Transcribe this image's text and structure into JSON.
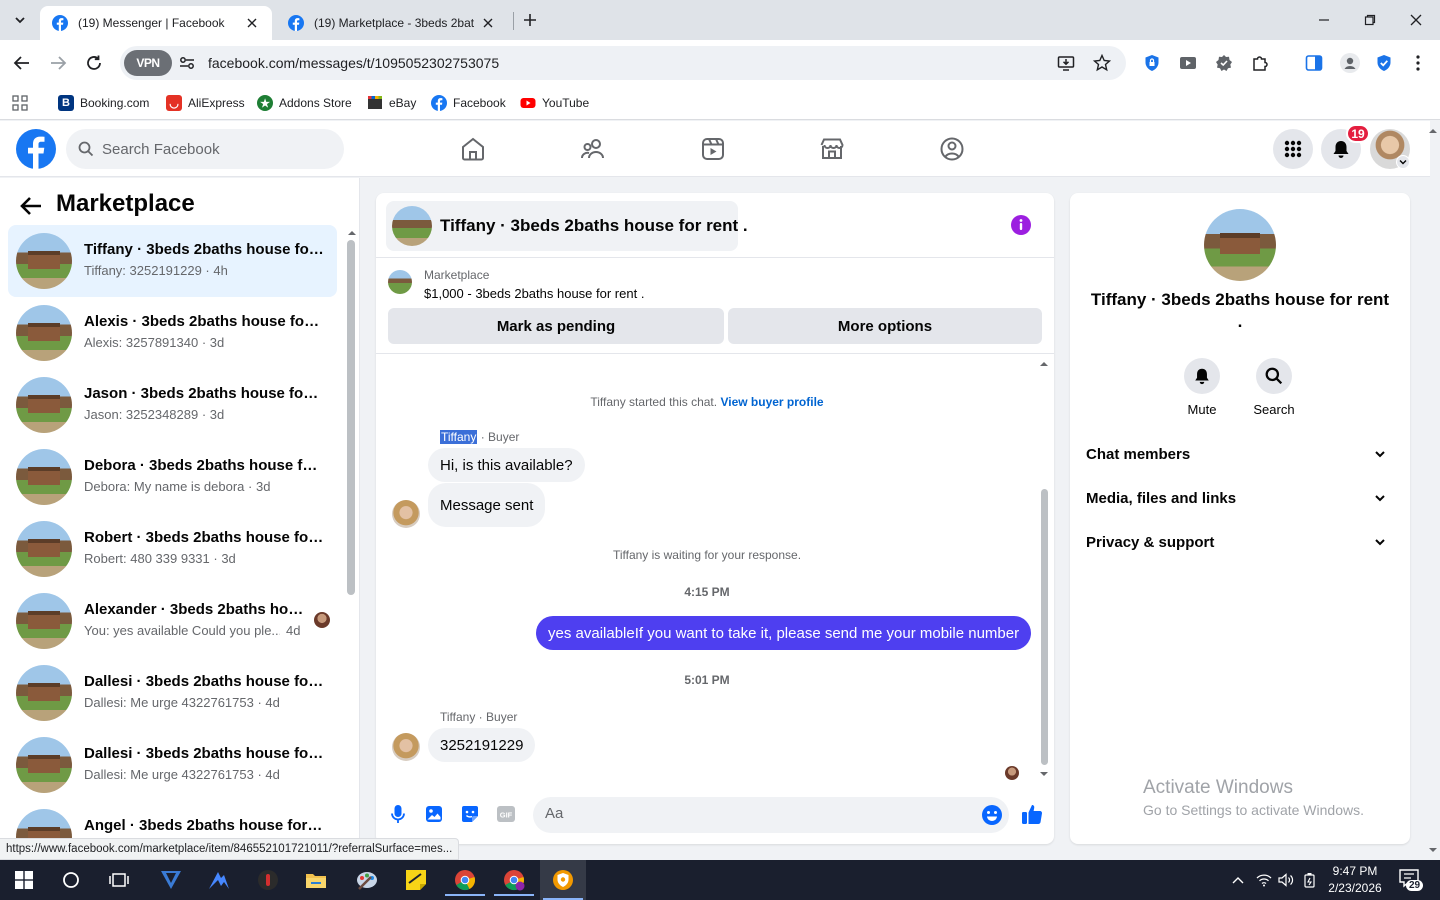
{
  "browser": {
    "tabs": [
      {
        "title": "(19) Messenger | Facebook",
        "active": true
      },
      {
        "title": "(19) Marketplace - 3beds 2baths",
        "active": false
      }
    ],
    "url": "facebook.com/messages/t/1095052302753075",
    "vpn_label": "VPN",
    "bookmarks": [
      {
        "label": "Booking.com",
        "icon": "booking-icon",
        "color": "#003580"
      },
      {
        "label": "AliExpress",
        "icon": "aliexpress-icon",
        "color": "#e43225"
      },
      {
        "label": "Addons Store",
        "icon": "addons-store-icon",
        "color": "#1e7e34"
      },
      {
        "label": "eBay",
        "icon": "ebay-icon",
        "color": "#333333"
      },
      {
        "label": "Facebook",
        "icon": "facebook-icon",
        "color": "#1877f2"
      },
      {
        "label": "YouTube",
        "icon": "youtube-icon",
        "color": "#ff0000"
      }
    ]
  },
  "fb": {
    "search_placeholder": "Search Facebook",
    "notification_count": "19",
    "brand_color": "#1877f2"
  },
  "marketplace": {
    "title": "Marketplace",
    "chats": [
      {
        "name": "Tiffany · 3beds 2baths house for...",
        "preview": "Tiffany: 3252191229 · 4h",
        "time": "",
        "active": true
      },
      {
        "name": "Alexis · 3beds 2baths house for r...",
        "preview": "Alexis: 3257891340 · 3d",
        "time": "",
        "active": false
      },
      {
        "name": "Jason · 3beds 2baths house for r...",
        "preview": "Jason: 3252348289 · 3d",
        "time": "",
        "active": false
      },
      {
        "name": "Debora · 3beds 2baths house fo...",
        "preview": "Debora: My name is debora · 3d",
        "time": "",
        "active": false
      },
      {
        "name": "Robert · 3beds 2baths house for...",
        "preview": "Robert: 480 339 9331 · 3d",
        "time": "",
        "active": false
      },
      {
        "name": "Alexander · 3beds 2baths hou...",
        "preview": "You: yes available Could you ple...",
        "time": "4d",
        "active": false
      },
      {
        "name": "Dallesi · 3beds 2baths house for ...",
        "preview": "Dallesi: Me urge 4322761753 · 4d",
        "time": "",
        "active": false
      },
      {
        "name": "Dallesi · 3beds 2baths house for ...",
        "preview": "Dallesi: Me urge 4322761753 · 4d",
        "time": "",
        "active": false
      },
      {
        "name": "Angel · 3beds 2baths house for r...",
        "preview": "",
        "time": "",
        "active": false
      }
    ]
  },
  "conversation": {
    "title": "Tiffany · 3beds 2baths house for rent .",
    "listing_source": "Marketplace",
    "listing_desc": "$1,000 - 3beds 2baths house for rent .",
    "btn_pending": "Mark as pending",
    "btn_more": "More options",
    "started_text": "Tiffany started this chat.",
    "view_profile": "View buyer profile",
    "sender1_name": "Tiffany",
    "sender1_role": " · Buyer",
    "msg1": "Hi, is this available?",
    "msg2": "Message sent",
    "waiting_text": "Tiffany is waiting for your response.",
    "time1": "4:15 PM",
    "msg_out": "yes availableIf you want to take it, please send me your mobile number",
    "time2": "5:01 PM",
    "sender2": "Tiffany · Buyer",
    "msg3": "3252191229",
    "composer_placeholder": "Aa",
    "outgoing_color": "#4e3ff0"
  },
  "info_panel": {
    "name": "Tiffany · 3beds 2baths house for rent .",
    "mute": "Mute",
    "search": "Search",
    "sections": [
      "Chat members",
      "Media, files and links",
      "Privacy & support"
    ],
    "watermark_title": "Activate Windows",
    "watermark_sub": "Go to Settings to activate Windows."
  },
  "status_url": "https://www.facebook.com/marketplace/item/846552101721011/?referralSurface=mes...",
  "taskbar": {
    "time": "9:47 PM",
    "date": "2/23/2026",
    "notif_count": "29"
  }
}
